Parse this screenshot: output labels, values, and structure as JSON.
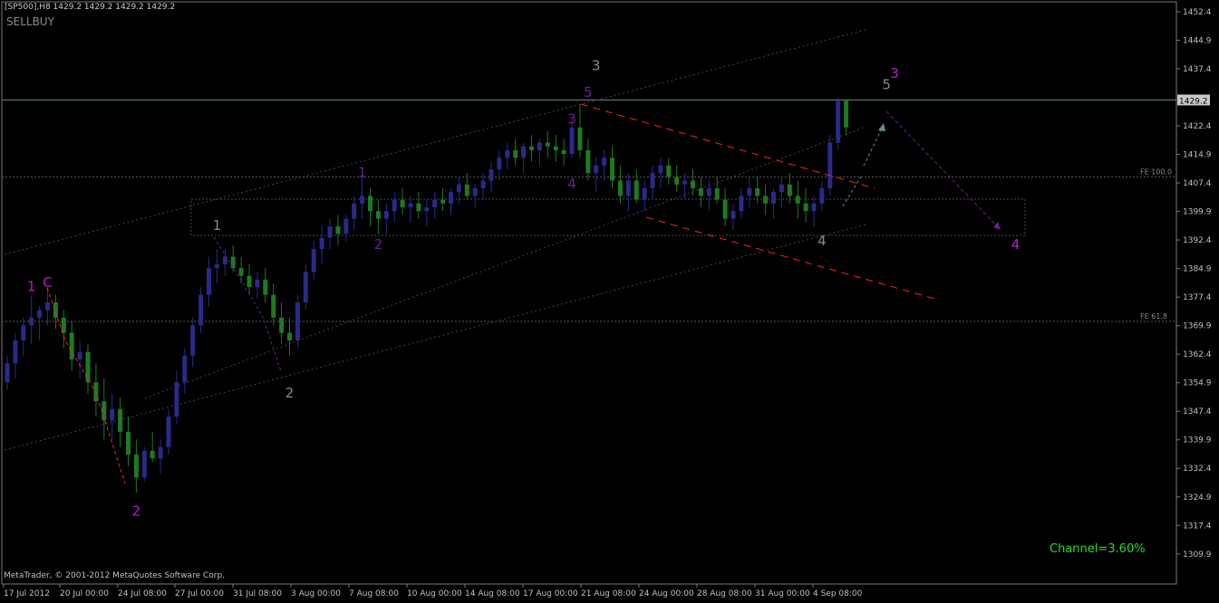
{
  "header": {
    "symbol_info": "[SP500],H8  1429.2 1429.2 1429.2 1429.2",
    "indicator": "SELLBUY"
  },
  "footer": {
    "copyright": "MetaTrader, © 2001-2012 MetaQuotes Software Corp."
  },
  "channel_text": "Channel=3.60%",
  "current_price": "1429.2",
  "price_axis": [
    "1452.4",
    "1444.9",
    "1437.4",
    "1422.4",
    "1414.9",
    "1407.4",
    "1399.9",
    "1392.4",
    "1384.9",
    "1377.4",
    "1369.9",
    "1362.4",
    "1354.9",
    "1347.4",
    "1339.9",
    "1332.4",
    "1324.9",
    "1317.4",
    "1309.9"
  ],
  "time_axis": [
    "17 Jul 2012",
    "20 Jul 00:00",
    "24 Jul 08:00",
    "27 Jul 00:00",
    "31 Jul 08:00",
    "3 Aug 00:00",
    "7 Aug 08:00",
    "10 Aug 00:00",
    "14 Aug 08:00",
    "17 Aug 00:00",
    "21 Aug 08:00",
    "24 Aug 00:00",
    "28 Aug 08:00",
    "31 Aug 00:00",
    "4 Sep 08:00"
  ],
  "levels": [
    {
      "label": "FE 100.0",
      "price": 1409.0
    },
    {
      "label": "FE 61.8",
      "price": 1371.0
    }
  ],
  "wave_labels": [
    {
      "text": "1",
      "color": "#b020c0",
      "x_idx": 3,
      "price": 1379
    },
    {
      "text": "C",
      "color": "#b020c0",
      "x_idx": 5,
      "price": 1380
    },
    {
      "text": "2",
      "color": "#b020c0",
      "x_idx": 16,
      "price": 1320
    },
    {
      "text": "1",
      "color": "#8a8a8a",
      "x_idx": 26,
      "price": 1395
    },
    {
      "text": "2",
      "color": "#8a8a8a",
      "x_idx": 35,
      "price": 1351
    },
    {
      "text": "1",
      "color": "#6a2090",
      "x_idx": 44,
      "price": 1409
    },
    {
      "text": "2",
      "color": "#6a2090",
      "x_idx": 46,
      "price": 1390
    },
    {
      "text": "3",
      "color": "#8a8a8a",
      "x_idx": 73,
      "price": 1437
    },
    {
      "text": "5",
      "color": "#6a2090",
      "x_idx": 72,
      "price": 1430
    },
    {
      "text": "3",
      "color": "#6a2090",
      "x_idx": 70,
      "price": 1423
    },
    {
      "text": "4",
      "color": "#6a2090",
      "x_idx": 70,
      "price": 1406
    },
    {
      "text": "4",
      "color": "#8a8a8a",
      "x_idx": 101,
      "price": 1391
    },
    {
      "text": "5",
      "color": "#8a8a8a",
      "x_idx": 109,
      "price": 1432
    },
    {
      "text": "3",
      "color": "#b020c0",
      "x_idx": 110,
      "price": 1435
    },
    {
      "text": "4",
      "color": "#b020c0",
      "x_idx": 125,
      "price": 1390
    }
  ],
  "chart_data": {
    "type": "candlestick",
    "symbol": "SP500",
    "timeframe": "H8",
    "ohlc": [
      [
        1355,
        1362,
        1353,
        1360
      ],
      [
        1360,
        1368,
        1356,
        1366
      ],
      [
        1366,
        1372,
        1362,
        1370
      ],
      [
        1370,
        1378,
        1365,
        1372
      ],
      [
        1372,
        1375,
        1366,
        1374
      ],
      [
        1374,
        1380,
        1370,
        1376
      ],
      [
        1376,
        1378,
        1369,
        1372
      ],
      [
        1372,
        1374,
        1364,
        1368
      ],
      [
        1368,
        1371,
        1358,
        1361
      ],
      [
        1361,
        1366,
        1356,
        1363
      ],
      [
        1363,
        1365,
        1352,
        1355
      ],
      [
        1355,
        1360,
        1346,
        1350
      ],
      [
        1350,
        1356,
        1340,
        1345
      ],
      [
        1345,
        1352,
        1340,
        1348
      ],
      [
        1348,
        1351,
        1338,
        1342
      ],
      [
        1342,
        1346,
        1333,
        1336
      ],
      [
        1336,
        1340,
        1326,
        1330
      ],
      [
        1330,
        1338,
        1329,
        1337
      ],
      [
        1337,
        1342,
        1334,
        1335
      ],
      [
        1335,
        1340,
        1331,
        1338
      ],
      [
        1338,
        1348,
        1336,
        1346
      ],
      [
        1346,
        1358,
        1344,
        1355
      ],
      [
        1355,
        1364,
        1352,
        1362
      ],
      [
        1362,
        1372,
        1359,
        1370
      ],
      [
        1370,
        1380,
        1368,
        1378
      ],
      [
        1378,
        1388,
        1375,
        1385
      ],
      [
        1385,
        1390,
        1381,
        1386
      ],
      [
        1386,
        1390,
        1383,
        1388
      ],
      [
        1388,
        1391,
        1384,
        1385
      ],
      [
        1385,
        1388,
        1381,
        1383
      ],
      [
        1383,
        1386,
        1378,
        1380
      ],
      [
        1380,
        1384,
        1377,
        1382
      ],
      [
        1382,
        1385,
        1376,
        1378
      ],
      [
        1378,
        1381,
        1370,
        1372
      ],
      [
        1372,
        1376,
        1365,
        1368
      ],
      [
        1368,
        1372,
        1362,
        1366
      ],
      [
        1366,
        1378,
        1364,
        1376
      ],
      [
        1376,
        1386,
        1374,
        1384
      ],
      [
        1384,
        1392,
        1382,
        1390
      ],
      [
        1390,
        1396,
        1386,
        1393
      ],
      [
        1393,
        1398,
        1390,
        1396
      ],
      [
        1396,
        1399,
        1391,
        1394
      ],
      [
        1394,
        1399,
        1392,
        1398
      ],
      [
        1398,
        1404,
        1395,
        1402
      ],
      [
        1402,
        1410,
        1398,
        1404
      ],
      [
        1404,
        1406,
        1396,
        1400
      ],
      [
        1400,
        1403,
        1394,
        1398
      ],
      [
        1398,
        1402,
        1394,
        1400
      ],
      [
        1400,
        1405,
        1397,
        1403
      ],
      [
        1403,
        1406,
        1399,
        1401
      ],
      [
        1401,
        1404,
        1397,
        1402
      ],
      [
        1402,
        1405,
        1398,
        1400
      ],
      [
        1400,
        1403,
        1396,
        1401
      ],
      [
        1401,
        1405,
        1398,
        1403
      ],
      [
        1403,
        1406,
        1400,
        1402
      ],
      [
        1402,
        1406,
        1399,
        1405
      ],
      [
        1405,
        1409,
        1402,
        1407
      ],
      [
        1407,
        1410,
        1403,
        1404
      ],
      [
        1404,
        1407,
        1401,
        1406
      ],
      [
        1406,
        1410,
        1403,
        1408
      ],
      [
        1408,
        1413,
        1405,
        1411
      ],
      [
        1411,
        1416,
        1408,
        1414
      ],
      [
        1414,
        1418,
        1411,
        1416
      ],
      [
        1416,
        1419,
        1412,
        1414
      ],
      [
        1414,
        1418,
        1410,
        1417
      ],
      [
        1417,
        1420,
        1413,
        1416
      ],
      [
        1416,
        1419,
        1412,
        1418
      ],
      [
        1418,
        1421,
        1414,
        1417
      ],
      [
        1417,
        1420,
        1413,
        1416
      ],
      [
        1416,
        1419,
        1412,
        1415
      ],
      [
        1415,
        1424,
        1414,
        1422
      ],
      [
        1422,
        1428,
        1414,
        1416
      ],
      [
        1416,
        1419,
        1408,
        1410
      ],
      [
        1410,
        1414,
        1405,
        1412
      ],
      [
        1412,
        1416,
        1408,
        1414
      ],
      [
        1414,
        1417,
        1406,
        1408
      ],
      [
        1408,
        1412,
        1402,
        1404
      ],
      [
        1404,
        1410,
        1400,
        1408
      ],
      [
        1408,
        1411,
        1402,
        1403
      ],
      [
        1403,
        1408,
        1400,
        1406
      ],
      [
        1406,
        1412,
        1403,
        1410
      ],
      [
        1410,
        1414,
        1406,
        1412
      ],
      [
        1412,
        1414,
        1407,
        1409
      ],
      [
        1409,
        1412,
        1405,
        1407
      ],
      [
        1407,
        1410,
        1403,
        1408
      ],
      [
        1408,
        1411,
        1404,
        1406
      ],
      [
        1406,
        1409,
        1401,
        1404
      ],
      [
        1404,
        1408,
        1400,
        1406
      ],
      [
        1406,
        1409,
        1402,
        1403
      ],
      [
        1403,
        1406,
        1396,
        1398
      ],
      [
        1398,
        1402,
        1395,
        1400
      ],
      [
        1400,
        1406,
        1398,
        1404
      ],
      [
        1404,
        1409,
        1401,
        1406
      ],
      [
        1406,
        1409,
        1402,
        1404
      ],
      [
        1404,
        1407,
        1399,
        1402
      ],
      [
        1402,
        1406,
        1398,
        1405
      ],
      [
        1405,
        1409,
        1401,
        1407
      ],
      [
        1407,
        1410,
        1402,
        1404
      ],
      [
        1404,
        1408,
        1398,
        1402
      ],
      [
        1402,
        1406,
        1397,
        1400
      ],
      [
        1400,
        1404,
        1396,
        1402
      ],
      [
        1402,
        1408,
        1400,
        1406
      ],
      [
        1406,
        1420,
        1404,
        1418
      ],
      [
        1418,
        1430,
        1416,
        1429
      ],
      [
        1429,
        1429,
        1420,
        1422
      ]
    ],
    "price_range": [
      1302,
      1455
    ]
  }
}
